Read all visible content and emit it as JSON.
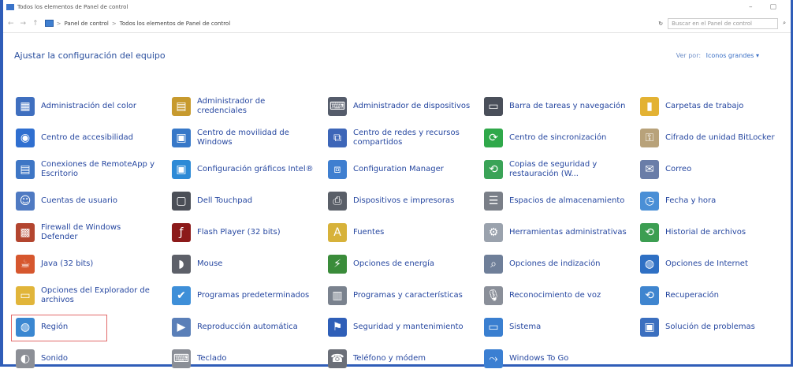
{
  "window": {
    "title": "Todos los elementos de Panel de control"
  },
  "titlebar": {
    "minimize": "–",
    "maximize": "▢"
  },
  "nav": {
    "back": "←",
    "forward": "→",
    "up": "↑"
  },
  "address": {
    "crumb1": "Panel de control",
    "crumb2": "Todos los elementos de Panel de control",
    "sep": ">",
    "refresh": "↻",
    "search_placeholder": "Buscar en el Panel de control",
    "search_icon": "⌕"
  },
  "header": {
    "title": "Ajustar la configuración del equipo",
    "view_by_label": "Ver por:",
    "view_by_value": "Iconos grandes ▾"
  },
  "items": [
    {
      "label": "Administración del color",
      "icon": "color-management-icon",
      "color": "#3f6fbf",
      "glyph": "▦"
    },
    {
      "label": "Administrador de credenciales",
      "icon": "credential-manager-icon",
      "color": "#c79a2e",
      "glyph": "▤"
    },
    {
      "label": "Administrador de dispositivos",
      "icon": "device-manager-icon",
      "color": "#555c6b",
      "glyph": "⌨"
    },
    {
      "label": "Barra de tareas y navegación",
      "icon": "taskbar-icon",
      "color": "#4a4f5a",
      "glyph": "▭"
    },
    {
      "label": "Carpetas de trabajo",
      "icon": "work-folders-icon",
      "color": "#e3b233",
      "glyph": "▮"
    },
    {
      "label": "Centro de accesibilidad",
      "icon": "accessibility-icon",
      "color": "#2f6fd0",
      "glyph": "◉"
    },
    {
      "label": "Centro de movilidad de Windows",
      "icon": "mobility-center-icon",
      "color": "#3778c8",
      "glyph": "▣"
    },
    {
      "label": "Centro de redes y recursos compartidos",
      "icon": "network-center-icon",
      "color": "#3d66b8",
      "glyph": "⧉"
    },
    {
      "label": "Centro de sincronización",
      "icon": "sync-center-icon",
      "color": "#2fa84a",
      "glyph": "⟳"
    },
    {
      "label": "Cifrado de unidad BitLocker",
      "icon": "bitlocker-icon",
      "color": "#b8a27a",
      "glyph": "⚿"
    },
    {
      "label": "Conexiones de RemoteApp y Escritorio",
      "icon": "remoteapp-icon",
      "color": "#3e76c5",
      "glyph": "▤"
    },
    {
      "label": "Configuración gráficos Intel®",
      "icon": "intel-graphics-icon",
      "color": "#2d8ad6",
      "glyph": "▣"
    },
    {
      "label": "Configuration Manager",
      "icon": "configuration-manager-icon",
      "color": "#3f7fd0",
      "glyph": "⧈"
    },
    {
      "label": "Copias de seguridad y restauración (W...",
      "icon": "backup-icon",
      "color": "#3aa357",
      "glyph": "⟲"
    },
    {
      "label": "Correo",
      "icon": "mail-icon",
      "color": "#6a7da8",
      "glyph": "✉"
    },
    {
      "label": "Cuentas de usuario",
      "icon": "user-accounts-icon",
      "color": "#4f7ac2",
      "glyph": "☺"
    },
    {
      "label": "Dell Touchpad",
      "icon": "touchpad-icon",
      "color": "#4b4f57",
      "glyph": "▢"
    },
    {
      "label": "Dispositivos e impresoras",
      "icon": "devices-printers-icon",
      "color": "#5a5f68",
      "glyph": "⎙"
    },
    {
      "label": "Espacios de almacenamiento",
      "icon": "storage-spaces-icon",
      "color": "#7a7f88",
      "glyph": "☰"
    },
    {
      "label": "Fecha y hora",
      "icon": "date-time-icon",
      "color": "#4a8fd6",
      "glyph": "◷"
    },
    {
      "label": "Firewall de Windows Defender",
      "icon": "firewall-icon",
      "color": "#b3452f",
      "glyph": "▩"
    },
    {
      "label": "Flash Player (32 bits)",
      "icon": "flash-player-icon",
      "color": "#8c1a1a",
      "glyph": "ƒ"
    },
    {
      "label": "Fuentes",
      "icon": "fonts-icon",
      "color": "#d7b23a",
      "glyph": "A"
    },
    {
      "label": "Herramientas administrativas",
      "icon": "admin-tools-icon",
      "color": "#9aa2ad",
      "glyph": "⚙"
    },
    {
      "label": "Historial de archivos",
      "icon": "file-history-icon",
      "color": "#3c9e52",
      "glyph": "⟲"
    },
    {
      "label": "Java (32 bits)",
      "icon": "java-icon",
      "color": "#d6572e",
      "glyph": "☕"
    },
    {
      "label": "Mouse",
      "icon": "mouse-icon",
      "color": "#5d6069",
      "glyph": "◗"
    },
    {
      "label": "Opciones de energía",
      "icon": "power-options-icon",
      "color": "#3a8c3a",
      "glyph": "⚡"
    },
    {
      "label": "Opciones de indización",
      "icon": "indexing-options-icon",
      "color": "#6f7f99",
      "glyph": "⌕"
    },
    {
      "label": "Opciones de Internet",
      "icon": "internet-options-icon",
      "color": "#2f70c4",
      "glyph": "◍"
    },
    {
      "label": "Opciones del Explorador de archivos",
      "icon": "explorer-options-icon",
      "color": "#e1b53a",
      "glyph": "▭"
    },
    {
      "label": "Programas predeterminados",
      "icon": "default-programs-icon",
      "color": "#3e8fd8",
      "glyph": "✔"
    },
    {
      "label": "Programas y características",
      "icon": "programs-features-icon",
      "color": "#7a828e",
      "glyph": "▥"
    },
    {
      "label": "Reconocimiento de voz",
      "icon": "speech-recognition-icon",
      "color": "#8a8f99",
      "glyph": "🎙"
    },
    {
      "label": "Recuperación",
      "icon": "recovery-icon",
      "color": "#3f85cf",
      "glyph": "⟲"
    },
    {
      "label": "Región",
      "icon": "region-icon",
      "color": "#3a87d1",
      "glyph": "◍"
    },
    {
      "label": "Reproducción automática",
      "icon": "autoplay-icon",
      "color": "#5a7fb8",
      "glyph": "▶"
    },
    {
      "label": "Seguridad y mantenimiento",
      "icon": "security-maintenance-icon",
      "color": "#2f5fb8",
      "glyph": "⚑"
    },
    {
      "label": "Sistema",
      "icon": "system-icon",
      "color": "#3a7fd0",
      "glyph": "▭"
    },
    {
      "label": "Solución de problemas",
      "icon": "troubleshooting-icon",
      "color": "#3b6fbf",
      "glyph": "▣"
    },
    {
      "label": "Sonido",
      "icon": "sound-icon",
      "color": "#8c8f96",
      "glyph": "◐"
    },
    {
      "label": "Teclado",
      "icon": "keyboard-icon",
      "color": "#8b8f97",
      "glyph": "⌨"
    },
    {
      "label": "Teléfono y módem",
      "icon": "phone-modem-icon",
      "color": "#6b6f78",
      "glyph": "☎"
    },
    {
      "label": "Windows To Go",
      "icon": "windows-to-go-icon",
      "color": "#3b7fd2",
      "glyph": "⤳"
    }
  ],
  "selected_item": "Región"
}
